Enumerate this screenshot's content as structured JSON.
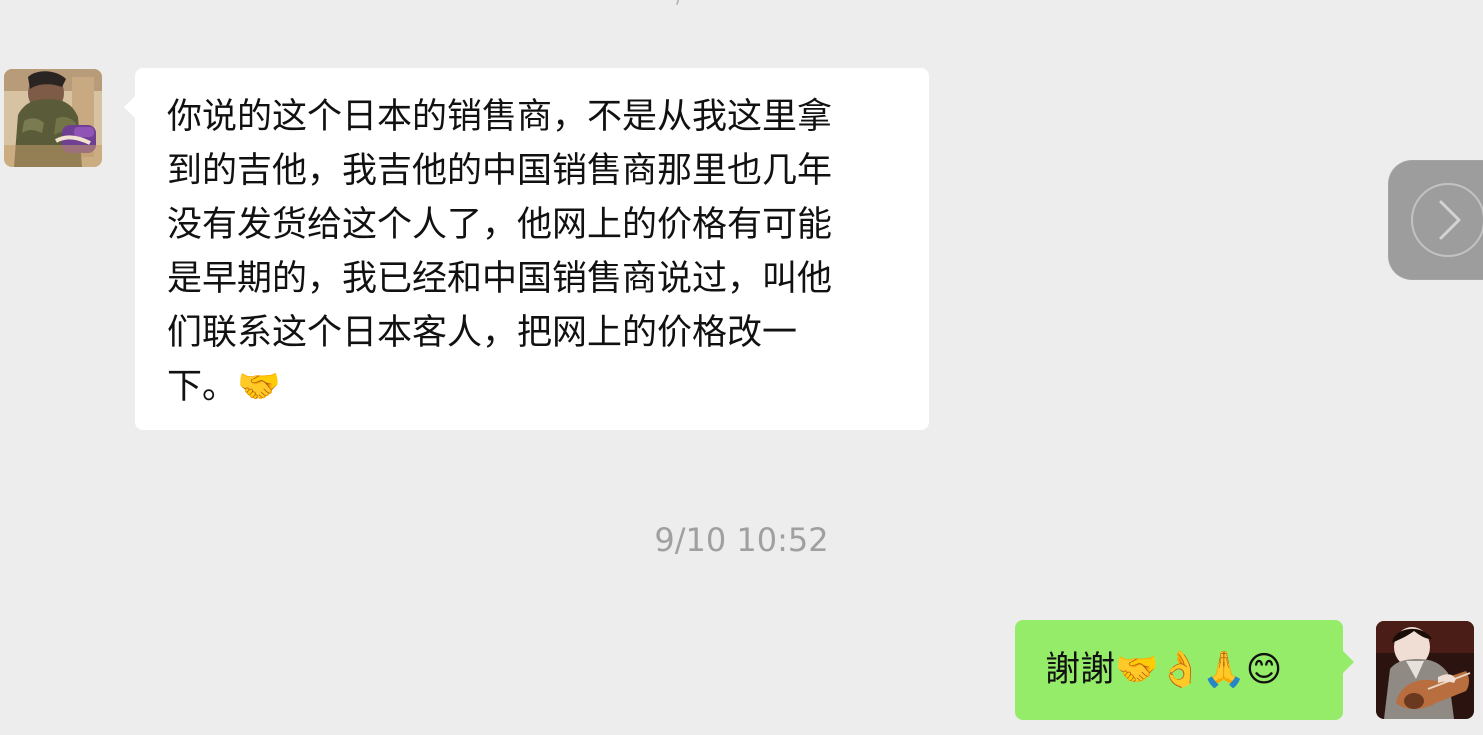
{
  "top": {
    "fragment": "/"
  },
  "messages": [
    {
      "sender": "other",
      "text": "你说的这个日本的销售商，不是从我这里拿\n到的吉他，我吉他的中国销售商那里也几年\n没有发货给这个人了，他网上的价格有可能\n是早期的，我已经和中国销售商说过，叫他\n们联系这个日本客人，把网上的价格改一\n下。🤝"
    },
    {
      "timestamp": "9/10 10:52"
    },
    {
      "sender": "self",
      "text": "謝謝🤝👌🙏😊"
    }
  ],
  "icons": {
    "side_button": "chevron-right-icon"
  },
  "colors": {
    "background": "#ededed",
    "incoming_bubble": "#ffffff",
    "outgoing_bubble": "#95ec69",
    "timestamp_text": "#a0a0a0"
  }
}
